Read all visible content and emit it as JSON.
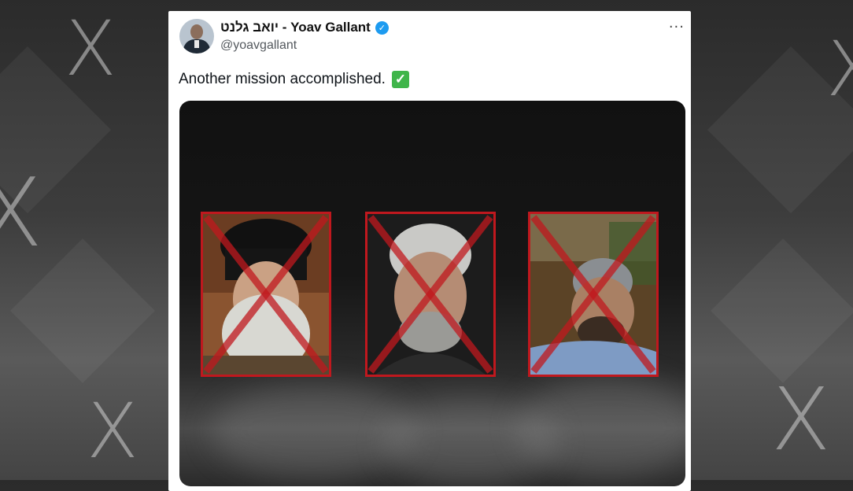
{
  "tweet": {
    "author_name": "יואב גלנט - Yoav Gallant",
    "handle": "@yoavgallant",
    "text": "Another mission accomplished.",
    "more_glyph": "···",
    "verified_glyph": "✓",
    "check_glyph": "✓"
  },
  "background": {
    "logo_glyph": "X"
  },
  "media": {
    "portraits": [
      {
        "id": "portrait-1",
        "crossed_out": true
      },
      {
        "id": "portrait-2",
        "crossed_out": true
      },
      {
        "id": "portrait-3",
        "crossed_out": true
      }
    ]
  },
  "colors": {
    "verified_badge": "#1d9bf0",
    "checkmark": "#3fb54a",
    "cross_out": "#c0181e"
  }
}
